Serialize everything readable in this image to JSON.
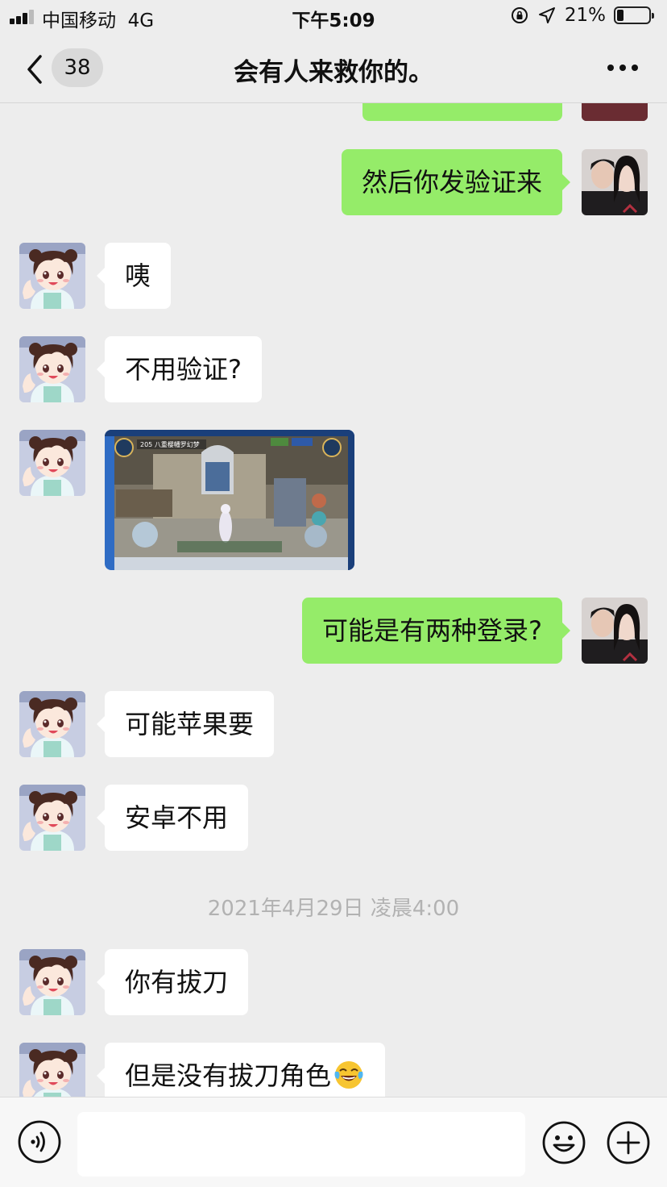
{
  "status_bar": {
    "carrier": "中国移动",
    "network": "4G",
    "time": "下午5:09",
    "battery_percent": "21%",
    "battery_level": 0.21
  },
  "nav": {
    "unread_count": "38",
    "title": "会有人来救你的。"
  },
  "messages": [
    {
      "type": "text",
      "side": "sent",
      "text": "然后你发验证来"
    },
    {
      "type": "text",
      "side": "received",
      "text": "咦"
    },
    {
      "type": "text",
      "side": "received",
      "text": "不用验证?"
    },
    {
      "type": "image",
      "side": "received",
      "caption": "205 八重樱幡罗幻梦"
    },
    {
      "type": "text",
      "side": "sent",
      "text": "可能是有两种登录?"
    },
    {
      "type": "text",
      "side": "received",
      "text": "可能苹果要"
    },
    {
      "type": "text",
      "side": "received",
      "text": "安卓不用"
    },
    {
      "type": "timestamp",
      "text": "2021年4月29日 凌晨4:00"
    },
    {
      "type": "text",
      "side": "received",
      "text": "你有拔刀"
    },
    {
      "type": "text",
      "side": "received",
      "text": "但是没有拔刀角色",
      "emoji": "tears-of-joy"
    }
  ],
  "input_bar": {
    "value": "",
    "icons": [
      "voice-icon",
      "emoji-icon",
      "plus-icon"
    ]
  },
  "colors": {
    "background": "#ededed",
    "sent_bubble": "#95ec69",
    "received_bubble": "#ffffff",
    "timestamp_text": "#b2b2b2"
  }
}
